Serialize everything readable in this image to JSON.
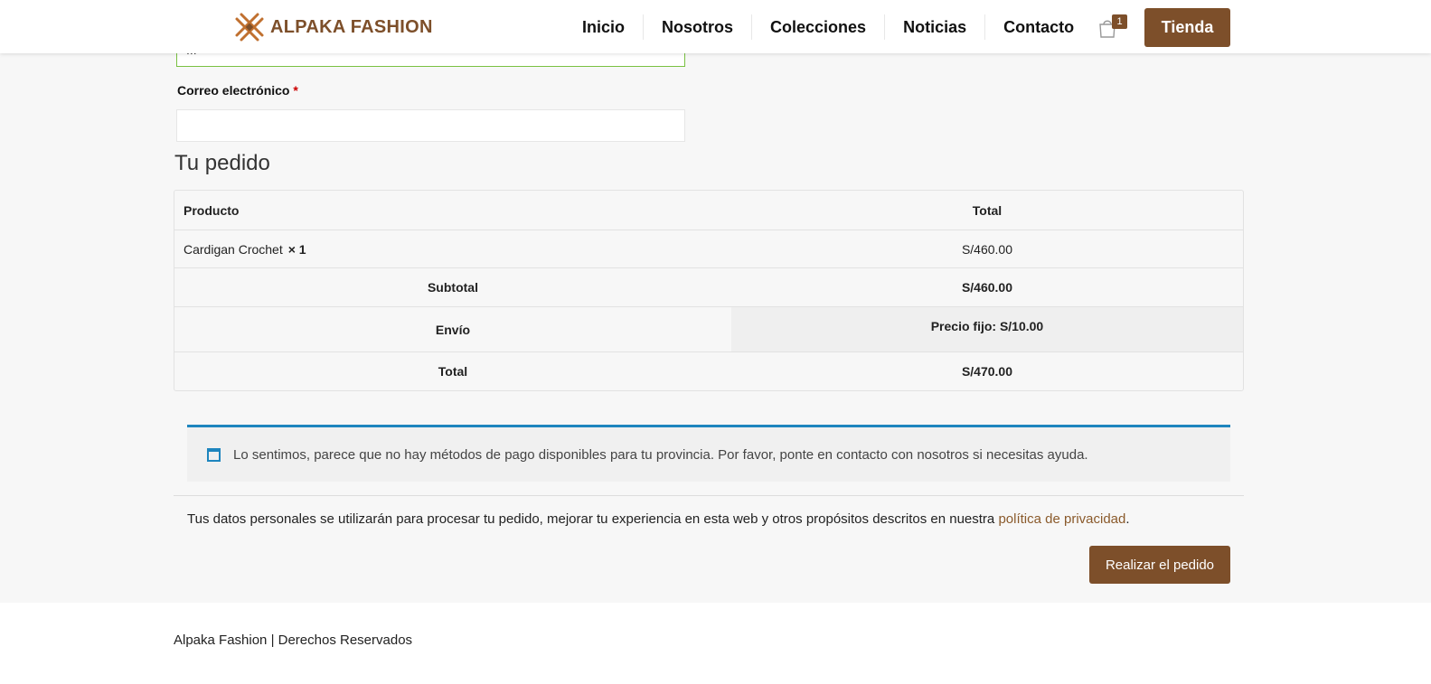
{
  "header": {
    "logo_text": "ALPAKA FASHION",
    "nav": [
      "Inicio",
      "Nosotros",
      "Colecciones",
      "Noticias",
      "Contacto"
    ],
    "cart_count": "1",
    "shop_button": "Tienda"
  },
  "form": {
    "prev_field_value": "...",
    "email_label": "Correo electrónico",
    "required_mark": "*",
    "email_value": ""
  },
  "order": {
    "title": "Tu pedido",
    "headers": {
      "product": "Producto",
      "total": "Total"
    },
    "item": {
      "name": "Cardigan Crochet",
      "qty": "× 1",
      "price": "S/460.00"
    },
    "subtotal": {
      "label": "Subtotal",
      "value": "S/460.00"
    },
    "shipping": {
      "label": "Envío",
      "value": "Precio fijo: S/10.00"
    },
    "total": {
      "label": "Total",
      "value": "S/470.00"
    }
  },
  "notice": {
    "text": "Lo sentimos, parece que no hay métodos de pago disponibles para tu provincia. Por favor, ponte en contacto con nosotros si necesitas ayuda."
  },
  "privacy": {
    "text": "Tus datos personales se utilizarán para procesar tu pedido, mejorar tu experiencia en esta web y otros propósitos descritos en nuestra",
    "link": "política de privacidad",
    "end": "."
  },
  "place_order_button": "Realizar el pedido",
  "footer": {
    "text": "Alpaka Fashion | Derechos Reservados"
  },
  "colors": {
    "brand": "#7d4f2a",
    "notice_accent": "#1e85be",
    "valid_border": "#7ac142"
  }
}
